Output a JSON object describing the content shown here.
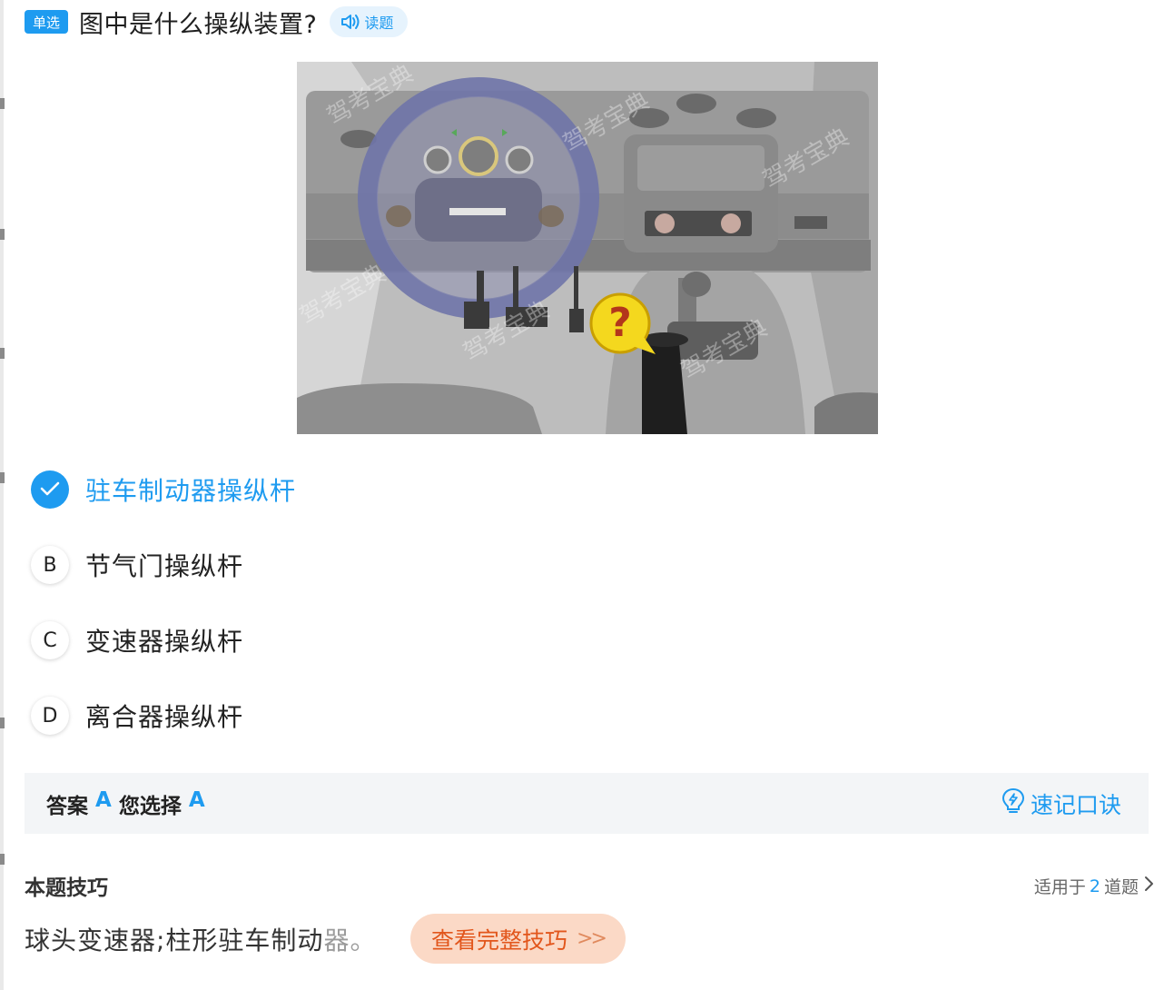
{
  "question": {
    "type_badge": "单选",
    "title": "图中是什么操纵装置?",
    "read_label": "读题"
  },
  "options": [
    {
      "letter": "A",
      "text": "驻车制动器操纵杆",
      "selected": true
    },
    {
      "letter": "B",
      "text": "节气门操纵杆",
      "selected": false
    },
    {
      "letter": "C",
      "text": "变速器操纵杆",
      "selected": false
    },
    {
      "letter": "D",
      "text": "离合器操纵杆",
      "selected": false
    }
  ],
  "answer": {
    "answer_label": "答案",
    "answer_value": "A",
    "choice_label": "您选择",
    "choice_value": "A",
    "mnemonic_label": "速记口诀"
  },
  "tips": {
    "title": "本题技巧",
    "applies_prefix": "适用于",
    "applies_count": "2",
    "applies_suffix": "道题",
    "text_main": "球头变速器;柱形驻车制动",
    "text_faded": "器。",
    "full_button": "查看完整技巧",
    "full_button_arrow": ">>"
  },
  "illustration": {
    "watermark": "驾考宝典",
    "question_mark": "?"
  },
  "colors": {
    "accent": "#1e9bf0",
    "tip_button_bg": "#fbd9c6",
    "tip_button_text": "#e2561c"
  }
}
